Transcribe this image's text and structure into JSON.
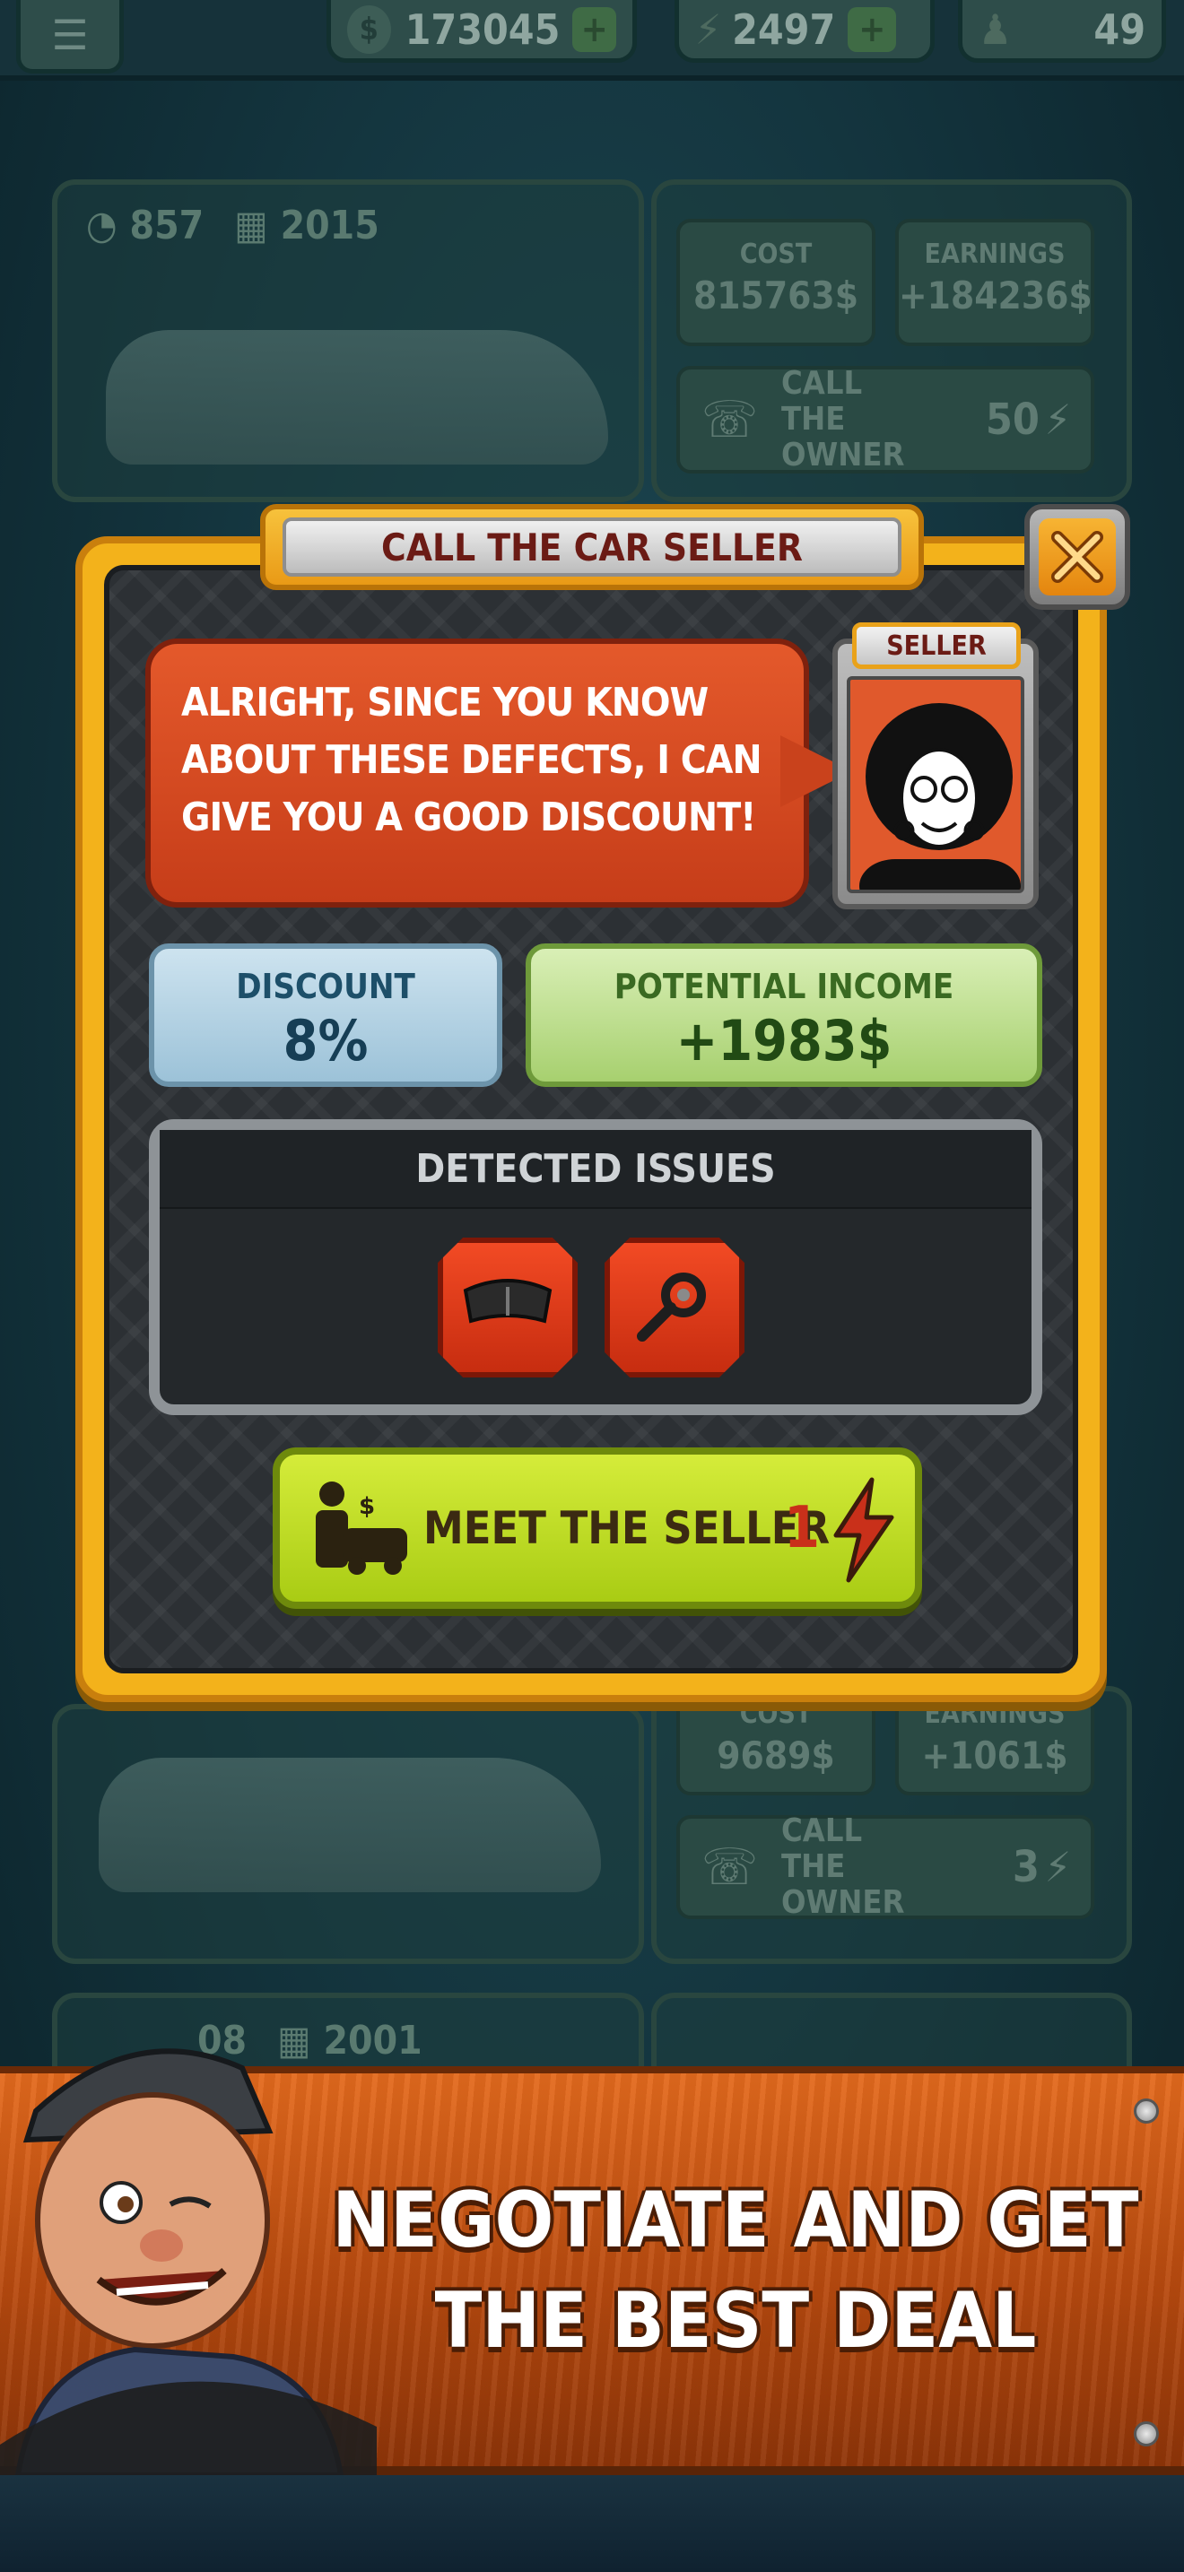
{
  "top_bar": {
    "money": "173045",
    "energy": "2497",
    "zen": "49"
  },
  "bg_cards": [
    {
      "mileage": "857",
      "year": "2015",
      "cost_label": "COST",
      "cost_value": "815763$",
      "earnings_label": "EARNINGS",
      "earnings_value": "+184236$",
      "call_label": "CALL THE OWNER",
      "call_cost": "50"
    },
    {
      "cost_label": "COST",
      "cost_value": "9689$",
      "earnings_label": "EARNINGS",
      "earnings_value": "+1061$",
      "call_label": "CALL THE OWNER",
      "call_cost": "3"
    },
    {
      "mileage": "08",
      "year": "2001"
    }
  ],
  "dialog": {
    "title": "CALL THE CAR SELLER",
    "speech": "ALRIGHT, SINCE YOU KNOW ABOUT THESE DEFECTS, I CAN GIVE YOU A GOOD DISCOUNT!",
    "seller_tag": "SELLER",
    "discount_label": "DISCOUNT",
    "discount_value": "8%",
    "income_label": "POTENTIAL INCOME",
    "income_value": "+1983$",
    "issues_title": "DETECTED ISSUES",
    "issues": [
      "brake-pads-icon",
      "suspension-joint-icon"
    ],
    "meet_button_label": "MEET THE SELLER",
    "meet_button_cost": "1"
  },
  "promo": {
    "text": "NEGOTIATE AND GET THE BEST DEAL"
  },
  "colors": {
    "dialog_border": "#f3b21b",
    "speech_bubble": "#d44a20",
    "meet_button": "#c3e02a",
    "promo_banner": "#c9551a"
  }
}
